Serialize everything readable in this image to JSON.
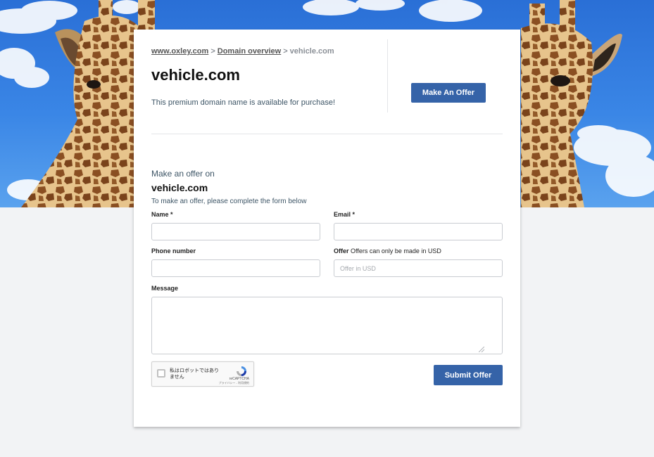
{
  "breadcrumb": {
    "site_link": "www.oxley.com",
    "separator": ">",
    "overview_link": "Domain overview",
    "current": "vehicle.com"
  },
  "header": {
    "domain": "vehicle.com",
    "lead": "This premium domain name is available for purchase!",
    "make_offer_button": "Make An Offer"
  },
  "offer_form": {
    "intro": "Make an offer on",
    "domain": "vehicle.com",
    "instructions": "To make an offer, please complete the form below",
    "name_label": "Name *",
    "name_value": "",
    "email_label": "Email *",
    "email_value": "",
    "phone_label": "Phone number",
    "phone_value": "",
    "offer_label": "Offer",
    "offer_note": "Offers can only be made in USD",
    "offer_placeholder": "Offer in USD",
    "message_label": "Message",
    "message_value": "",
    "submit_button": "Submit Offer"
  },
  "captcha": {
    "label": "私はロボットではありません",
    "brand": "reCAPTCHA",
    "links": "プライバシー - 利用規約"
  },
  "colors": {
    "accent": "#3563a8",
    "sky": "#2a6fd6",
    "page_background": "#f2f3f5",
    "muted_text": "#3d5566"
  },
  "icons": [
    "recaptcha-logo-icon",
    "resize-grip-icon",
    "checkbox-icon"
  ]
}
